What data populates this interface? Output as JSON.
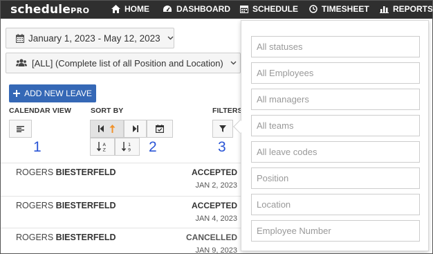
{
  "navbar": {
    "logo": "schedule",
    "logo_suffix": "PRO",
    "items": [
      {
        "label": "HOME",
        "icon": "home-icon"
      },
      {
        "label": "DASHBOARD",
        "icon": "dashboard-icon"
      },
      {
        "label": "SCHEDULE",
        "icon": "calendar-icon"
      },
      {
        "label": "TIMESHEET",
        "icon": "clock-icon"
      },
      {
        "label": "REPORTS",
        "icon": "bar-chart-icon"
      }
    ]
  },
  "date_range": {
    "label": "January 1, 2023 - May 12, 2023",
    "icon": "calendar-icon"
  },
  "scope": {
    "label": "[ALL] (Complete list of all Position and Location)",
    "icon": "users-icon"
  },
  "add_button": {
    "label": "ADD NEW LEAVE",
    "icon": "plus-icon"
  },
  "sections": {
    "calendar_view": "CALENDAR VIEW",
    "sort_by": "SORT BY",
    "filters": "FILTERS"
  },
  "annotations": [
    "1",
    "2",
    "3"
  ],
  "leaves": [
    {
      "first": "ROGERS",
      "last": "BIESTERFELD",
      "status": "ACCEPTED",
      "date": "JAN 2, 2023"
    },
    {
      "first": "ROGERS",
      "last": "BIESTERFELD",
      "status": "ACCEPTED",
      "date": "JAN 4, 2023"
    },
    {
      "first": "ROGERS",
      "last": "BIESTERFELD",
      "status": "CANCELLED",
      "date": "JAN 9, 2023"
    }
  ],
  "filters": {
    "placeholders": [
      "All statuses",
      "All Employees",
      "All managers",
      "All teams",
      "All leave codes",
      "Position",
      "Location",
      "Employee Number"
    ]
  },
  "colors": {
    "navbar": "#2f2f2f",
    "accent": "#3568b6",
    "annotation": "#2a55d6",
    "sort_arrow": "#f0922b"
  }
}
